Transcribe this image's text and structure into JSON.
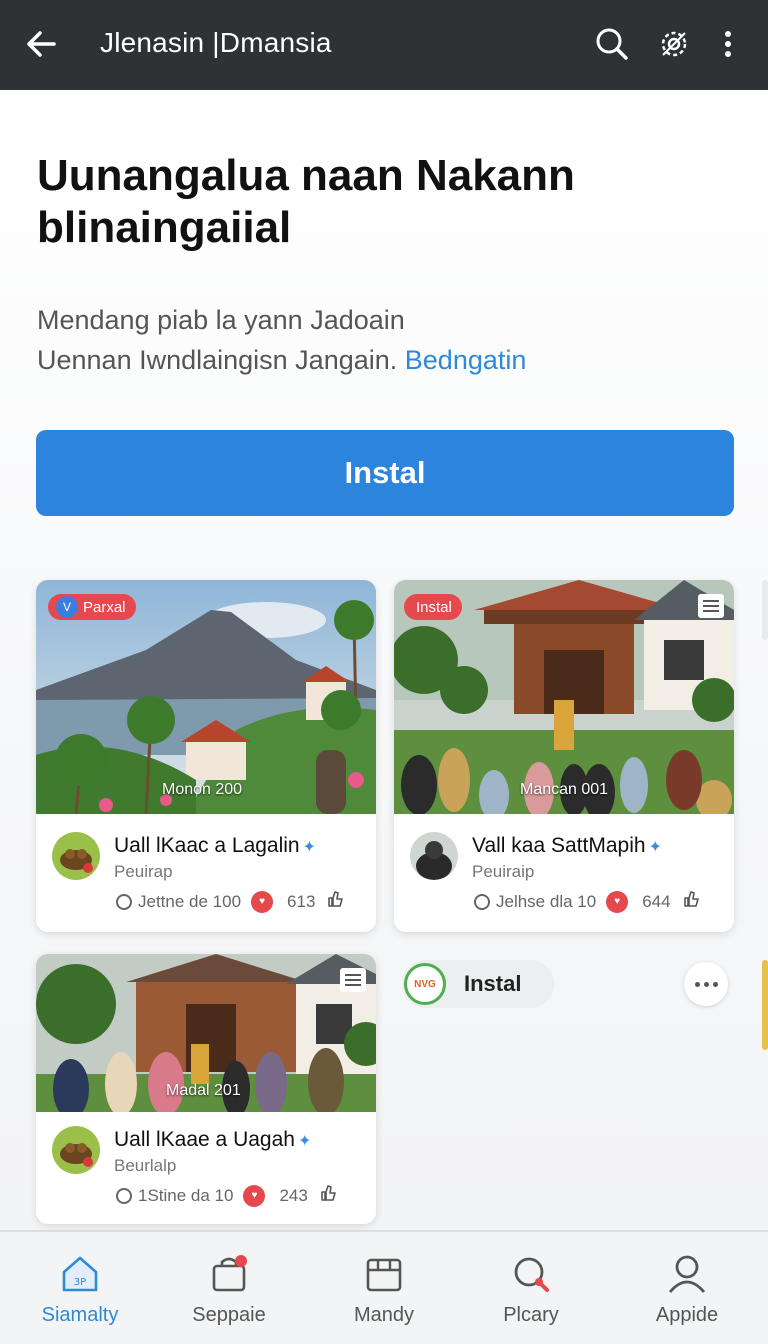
{
  "appbar": {
    "title": "Jlenasin |Dmansia"
  },
  "header": {
    "headline": "Uunangalua naan Nakann blinaingaiial",
    "desc_line1": "Mendang piab la yann Jadoain",
    "desc_line2": "Uennan Iwndlaingisn Jangain.",
    "desc_link": "Bedngatin",
    "install_label": "Instal"
  },
  "cards": [
    {
      "badge": "Parxal",
      "badge_icon": "V",
      "caption": "Monon 200",
      "title": "Uall lKaac a Lagalin",
      "subtitle": "Peuirap",
      "meta_text": "Jettne de 100",
      "count": "613"
    },
    {
      "badge": "Instal",
      "caption": "Mancan 001",
      "title": "Vall kaa SattMapih",
      "subtitle": "Peuiraip",
      "meta_text": "Jelhse dla  10",
      "count": "644"
    },
    {
      "caption": "Madal 201",
      "title": "Uall lKaae a Uagah",
      "subtitle": "Beurlalp",
      "meta_text": "1Stine da  10",
      "count": "243"
    }
  ],
  "chip": {
    "logo_text": "NVG",
    "label": "Instal"
  },
  "bottom_nav": [
    {
      "label": "Siamalty",
      "icon": "home-icon",
      "active": true
    },
    {
      "label": "Seppaie",
      "icon": "shopping-bag-icon",
      "active": false
    },
    {
      "label": "Mandy",
      "icon": "store-icon",
      "active": false
    },
    {
      "label": "Plcary",
      "icon": "search-location-icon",
      "active": false
    },
    {
      "label": "Appide",
      "icon": "profile-icon",
      "active": false
    }
  ],
  "colors": {
    "appbar_bg": "#2f3234",
    "primary": "#2c84dc",
    "link": "#2e8ad8",
    "badge_red": "#e5484d"
  }
}
